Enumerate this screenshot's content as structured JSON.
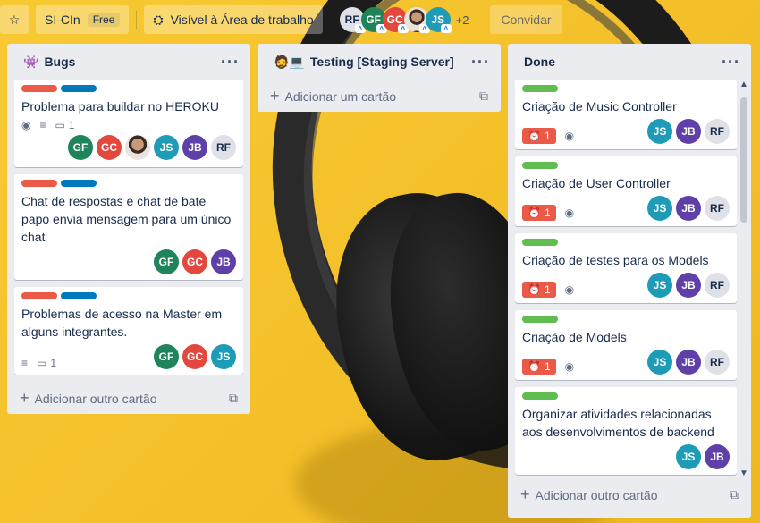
{
  "header": {
    "board_name": "SI-CIn",
    "plan_badge": "Free",
    "visibility": "Visível à Área de trabalho",
    "members": [
      "RF",
      "GF",
      "GC",
      "",
      "JS"
    ],
    "extra_members": "+2",
    "invite_label": "Convidar"
  },
  "lists": [
    {
      "title": "Bugs",
      "emoji": "👾",
      "cards": [
        {
          "labels": [
            "red",
            "blue"
          ],
          "title": "Problema para buildar no HEROKU",
          "watch": true,
          "desc": true,
          "comments": "1",
          "members": [
            "GF",
            "GC",
            "photo",
            "JS",
            "JB",
            "RF"
          ]
        },
        {
          "labels": [
            "red",
            "blue"
          ],
          "title": "Chat de respostas e chat de bate papo envia mensagem para um único chat",
          "members": [
            "GF",
            "GC",
            "JB"
          ]
        },
        {
          "labels": [
            "red",
            "blue"
          ],
          "title": "Problemas de acesso na Master em alguns integrantes.",
          "desc": true,
          "comments": "1",
          "members": [
            "GF",
            "GC",
            "JS"
          ]
        }
      ],
      "add_label": "Adicionar outro cartão"
    },
    {
      "title": "Testing [Staging Server]",
      "emoji": "🧔💻",
      "cards": [],
      "add_label": "Adicionar um cartão"
    },
    {
      "title": "Done",
      "cards": [
        {
          "labels": [
            "green"
          ],
          "title": "Criação de Music Controller",
          "due": "1",
          "watch": true,
          "members": [
            "JS",
            "JB",
            "RF"
          ]
        },
        {
          "labels": [
            "green"
          ],
          "title": "Criação de User Controller",
          "due": "1",
          "watch": true,
          "members": [
            "JS",
            "JB",
            "RF"
          ]
        },
        {
          "labels": [
            "green"
          ],
          "title": "Criação de testes para os Models",
          "due": "1",
          "watch": true,
          "members": [
            "JS",
            "JB",
            "RF"
          ]
        },
        {
          "labels": [
            "green"
          ],
          "title": "Criação de Models",
          "due": "1",
          "watch": true,
          "members": [
            "JS",
            "JB",
            "RF"
          ]
        },
        {
          "labels": [
            "green"
          ],
          "title": "Organizar atividades relacionadas aos desenvolvimentos de backend",
          "members": [
            "JS",
            "JB"
          ]
        }
      ],
      "add_label": "Adicionar outro cartão"
    }
  ],
  "colors": {
    "label_red": "#eb5a46",
    "label_blue": "#0079bf",
    "label_green": "#61bd4f",
    "background": "#f6c531"
  }
}
